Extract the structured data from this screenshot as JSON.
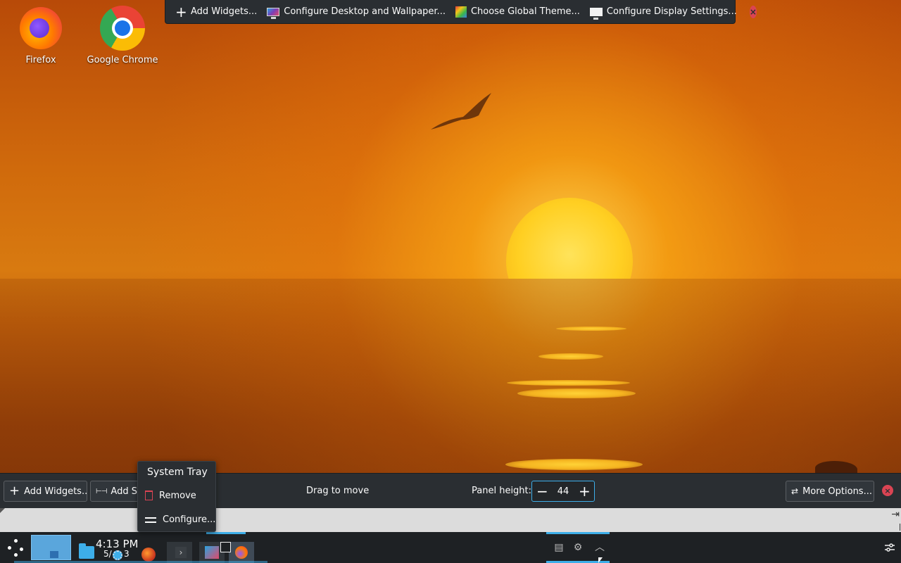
{
  "desktop": {
    "icons": [
      {
        "label": "Firefox",
        "icon": "firefox-icon"
      },
      {
        "label": "Google Chrome",
        "icon": "chrome-icon"
      }
    ]
  },
  "top_toolbar": {
    "items": [
      {
        "label": "Add Widgets...",
        "icon": "plus-icon"
      },
      {
        "label": "Configure Desktop and Wallpaper...",
        "icon": "desktop-wallpaper-icon"
      },
      {
        "label": "Choose Global Theme...",
        "icon": "global-theme-icon"
      },
      {
        "label": "Configure Display Settings...",
        "icon": "display-settings-icon"
      }
    ],
    "close_icon": "close-icon"
  },
  "panel_config": {
    "add_widgets_label": "Add Widgets...",
    "add_spacer_label": "Add Sp",
    "drag_to_move_label": "Drag to move",
    "panel_height_label": "Panel height:",
    "panel_height_value": "44",
    "more_options_label": "More Options...",
    "colors": {
      "accent": "#3daee9",
      "close": "#da4453",
      "bar_bg": "#2a2e32"
    }
  },
  "context_menu": {
    "title": "System Tray",
    "items": [
      {
        "label": "Remove",
        "icon": "trash-icon"
      },
      {
        "label": "Configure...",
        "icon": "configure-icon"
      }
    ]
  },
  "taskbar": {
    "time": "4:13 PM",
    "date": "5/",
    "date_suffix": "3",
    "tray_icons": [
      "clipboard-icon",
      "network-icon",
      "chevron-up-icon"
    ]
  }
}
